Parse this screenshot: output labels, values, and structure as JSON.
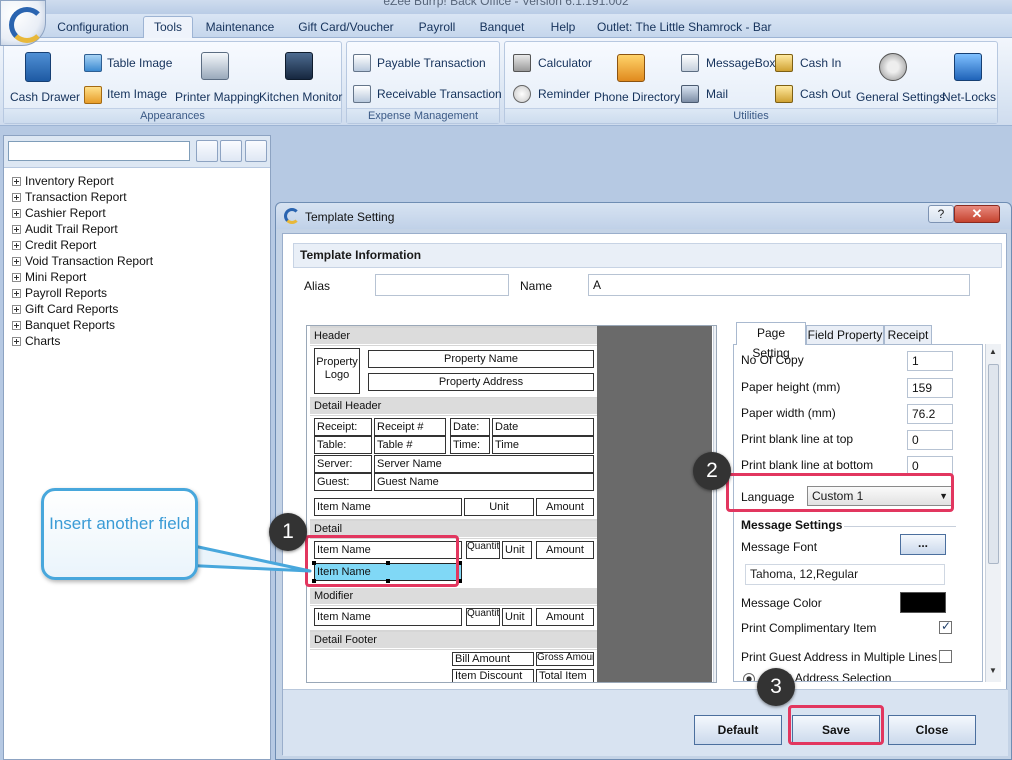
{
  "window": {
    "title": "eZee Burrp! Back Office - Version 6.1.191.002"
  },
  "menu": {
    "tabs": [
      "Configuration",
      "Tools",
      "Maintenance",
      "Gift Card/Voucher",
      "Payroll",
      "Banquet",
      "Help",
      "Outlet: The Little Shamrock - Bar"
    ],
    "active": "Tools"
  },
  "ribbon": {
    "appearances": {
      "label": "Appearances",
      "cash_drawer": "Cash Drawer",
      "table_image": "Table Image",
      "item_image": "Item Image",
      "printer_mapping": "Printer Mapping",
      "kitchen_monitor": "Kitchen Monitor"
    },
    "expense": {
      "label": "Expense Management",
      "payable": "Payable Transaction",
      "receivable": "Receivable Transaction"
    },
    "utilities": {
      "label": "Utilities",
      "calculator": "Calculator",
      "reminder": "Reminder",
      "phone_directory": "Phone Directory",
      "message_box": "MessageBox",
      "mail": "Mail",
      "cash_in": "Cash In",
      "cash_out": "Cash Out",
      "general_settings": "General Settings",
      "net_locks": "Net-Locks"
    }
  },
  "tree": {
    "items": [
      "Inventory Report",
      "Transaction Report",
      "Cashier Report",
      "Audit Trail Report",
      "Credit Report",
      "Void Transaction Report",
      "Mini Report",
      "Payroll Reports",
      "Gift Card Reports",
      "Banquet Reports",
      "Charts"
    ]
  },
  "dialog": {
    "title": "Template Setting",
    "help": "?",
    "close": "✕",
    "section_title": "Template Information",
    "alias_label": "Alias",
    "alias_value": "",
    "name_label": "Name",
    "name_value": "A",
    "preview": {
      "header": "Header",
      "property_logo": "Property Logo",
      "property_name": "Property Name",
      "property_address": "Property Address",
      "detail_header": "Detail Header",
      "receipt_lbl": "Receipt:",
      "receipt_val": "Receipt #",
      "date_lbl": "Date:",
      "date_val": "Date",
      "table_lbl": "Table:",
      "table_val": "Table #",
      "time_lbl": "Time:",
      "time_val": "Time",
      "server_lbl": "Server:",
      "server_val": "Server Name",
      "guest_lbl": "Guest:",
      "guest_val": "Guest Name",
      "item_name": "Item Name",
      "unit": "Unit",
      "amount": "Amount",
      "detail": "Detail",
      "quantity": "Quantity",
      "modifier": "Modifier",
      "detail_footer": "Detail Footer",
      "bill_amount": "Bill Amount",
      "gross_amount": "Gross Amount",
      "item_discount": "Item Discount",
      "total_item": "Total Item"
    },
    "tabs": [
      "Page Setting",
      "Field Property",
      "Receipt"
    ],
    "settings": {
      "no_of_copy_label": "No Of Copy",
      "no_of_copy": "1",
      "paper_height_label": "Paper height (mm)",
      "paper_height": "159",
      "paper_width_label": "Paper width (mm)",
      "paper_width": "76.2",
      "blank_top_label": "Print blank line at top",
      "blank_top": "0",
      "blank_bottom_label": "Print blank line at bottom",
      "blank_bottom": "0",
      "language_label": "Language",
      "language": "Custom 1",
      "message_settings": "Message Settings",
      "message_font_label": "Message Font",
      "font_btn": "...",
      "message_font": "Tahoma, 12,Regular",
      "message_color_label": "Message Color",
      "message_color": "#000000",
      "print_complimentary_label": "Print Complimentary Item",
      "print_guest_address_label": "Print Guest Address in Multiple Lines",
      "guest_address_selection": "Guest Address Selection"
    },
    "buttons": {
      "default": "Default",
      "save": "Save",
      "close": "Close"
    }
  },
  "annotations": {
    "callout": "Insert another field",
    "step1": "1",
    "step2": "2",
    "step3": "3",
    "highlight_color": "#e2365f",
    "callout_color": "#48a7dc"
  }
}
